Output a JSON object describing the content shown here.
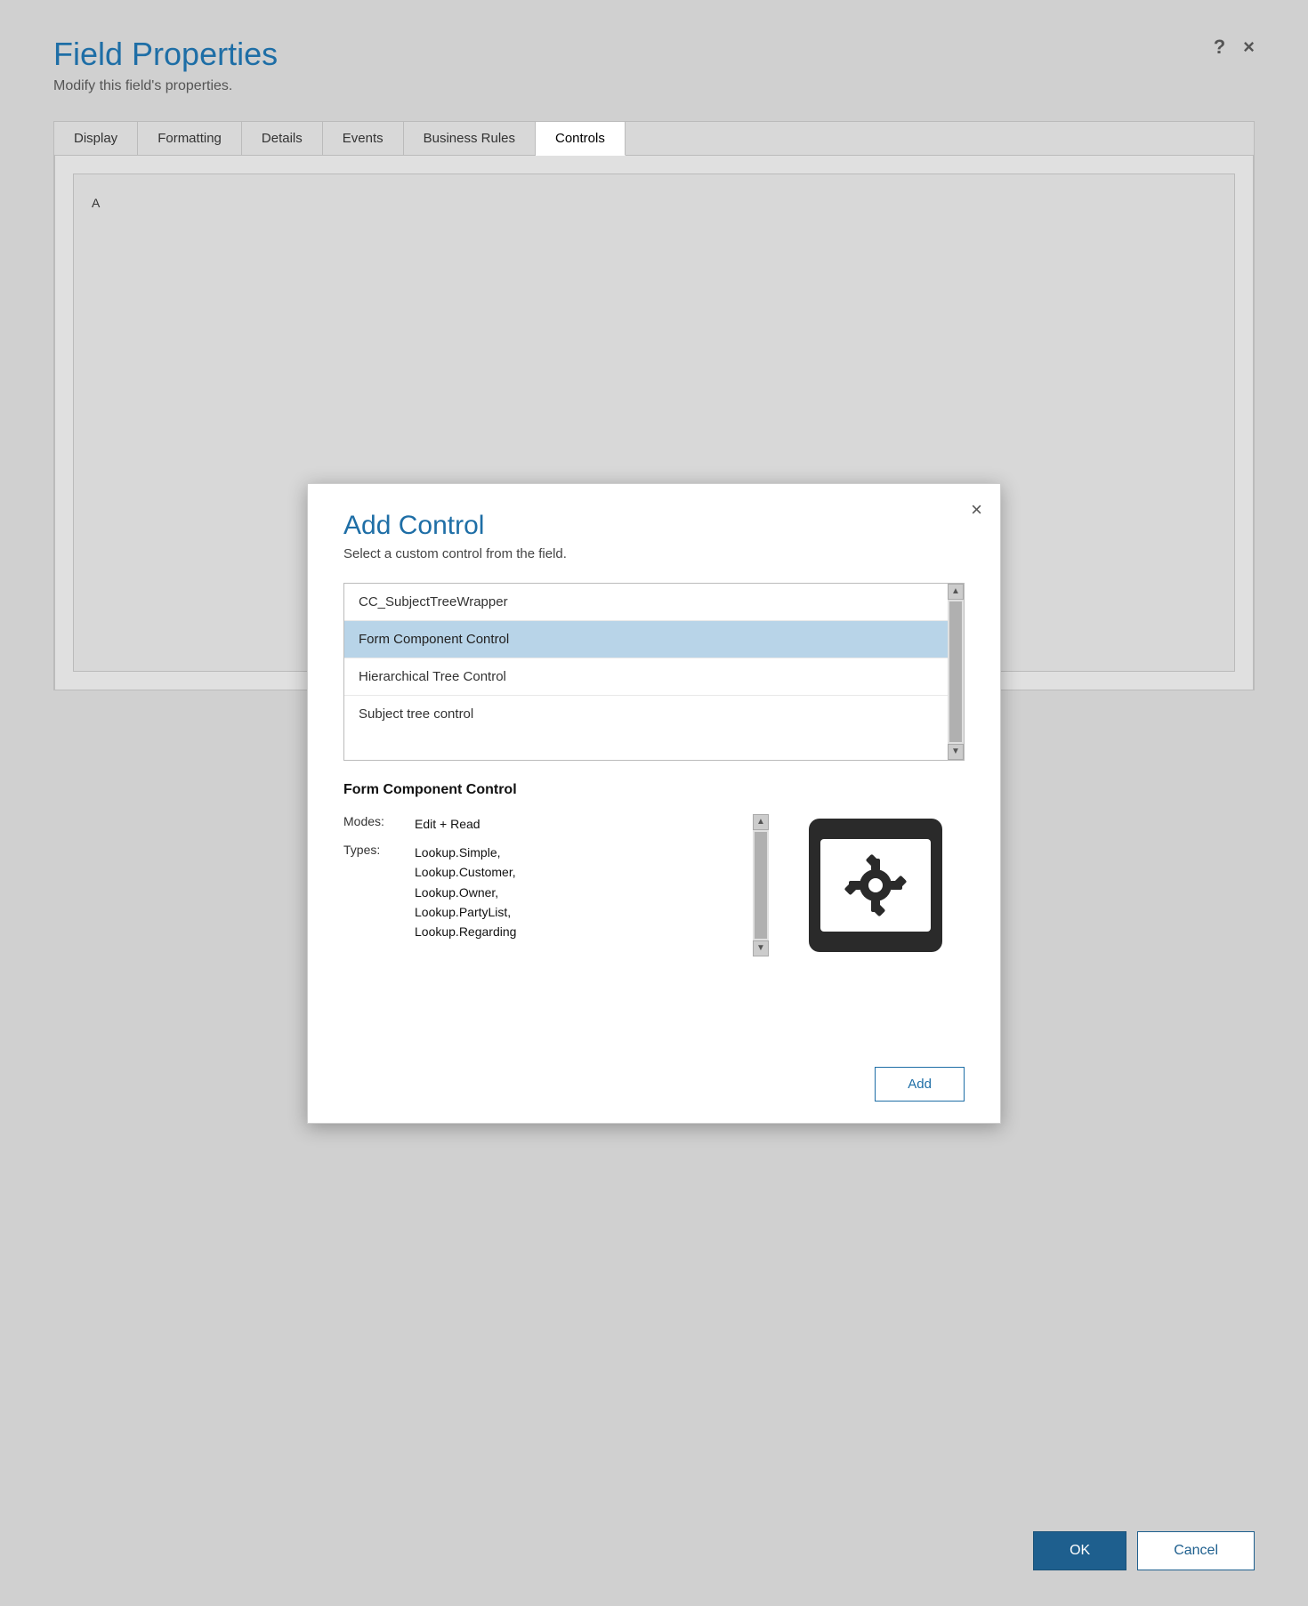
{
  "page": {
    "background_color": "#d0d0d0"
  },
  "field_properties": {
    "title": "Field Properties",
    "subtitle": "Modify this field's properties.",
    "help_icon": "?",
    "close_icon": "×"
  },
  "tabs": {
    "items": [
      {
        "label": "Display",
        "active": false
      },
      {
        "label": "Formatting",
        "active": false
      },
      {
        "label": "Details",
        "active": false
      },
      {
        "label": "Events",
        "active": false
      },
      {
        "label": "Business Rules",
        "active": false
      },
      {
        "label": "Controls",
        "active": true
      }
    ]
  },
  "bottom_buttons": {
    "ok_label": "OK",
    "cancel_label": "Cancel"
  },
  "modal": {
    "close_icon": "×",
    "title": "Add Control",
    "subtitle": "Select a custom control from the field.",
    "control_list": [
      {
        "label": "CC_SubjectTreeWrapper",
        "selected": false
      },
      {
        "label": "Form Component Control",
        "selected": true
      },
      {
        "label": "Hierarchical Tree Control",
        "selected": false
      },
      {
        "label": "Subject tree control",
        "selected": false
      }
    ],
    "selected_control": {
      "title": "Form Component Control",
      "modes_label": "Modes:",
      "modes_value": "Edit + Read",
      "types_label": "Types:",
      "types_value": "Lookup.Simple,\nLookup.Customer,\nLookup.Owner,\nLookup.PartyList,\nLookup.Regarding"
    },
    "add_button_label": "Add"
  }
}
